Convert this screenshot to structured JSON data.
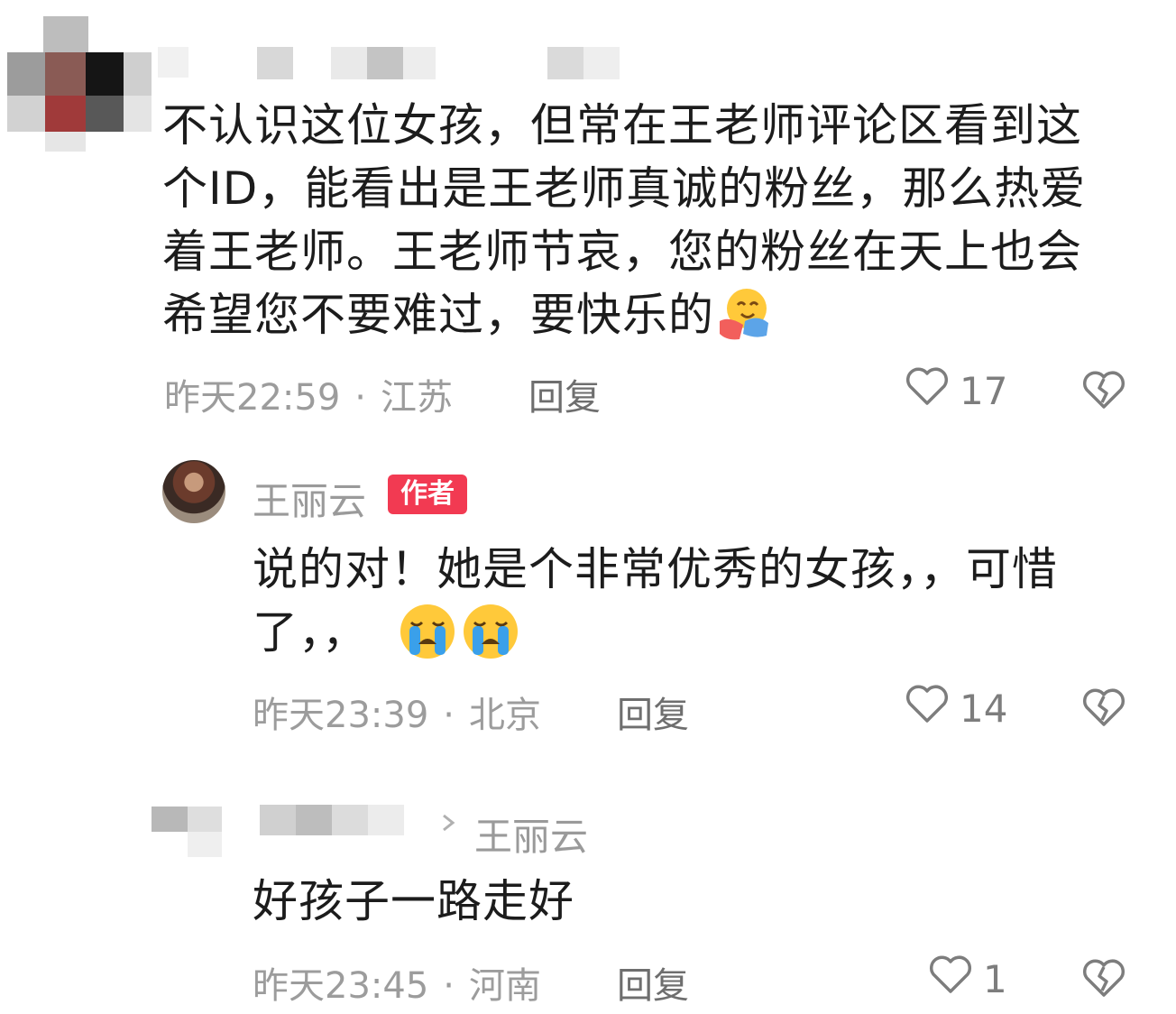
{
  "comments": [
    {
      "text_lines": [
        "不认识这位女孩，但常在王老师评论区看到这",
        "个ID，能看出是王老师真诚的粉丝，那么热爱",
        "着王老师。王老师节哀，您的粉丝在天上也会",
        "希望您不要难过，要快乐的"
      ],
      "emoji": "hugging-face-emoji",
      "time": "昨天22:59",
      "location": "江苏",
      "reply_label": "回复",
      "likes": "17"
    },
    {
      "author": "王丽云",
      "author_badge": "作者",
      "text_lines": [
        "说的对！她是个非常优秀的女孩，，可惜",
        "了，，"
      ],
      "emoji": "loudly-crying-face-emoji",
      "time": "昨天23:39",
      "location": "北京",
      "reply_label": "回复",
      "likes": "14"
    },
    {
      "reply_to": "王丽云",
      "text_lines": [
        "好孩子一路走好"
      ],
      "time": "昨天23:45",
      "location": "河南",
      "reply_label": "回复",
      "likes": "1"
    }
  ],
  "meta_separator": "·",
  "colors": {
    "badge": "#f23a52",
    "meta": "#9c9c9c",
    "text": "#1c1c1c"
  }
}
